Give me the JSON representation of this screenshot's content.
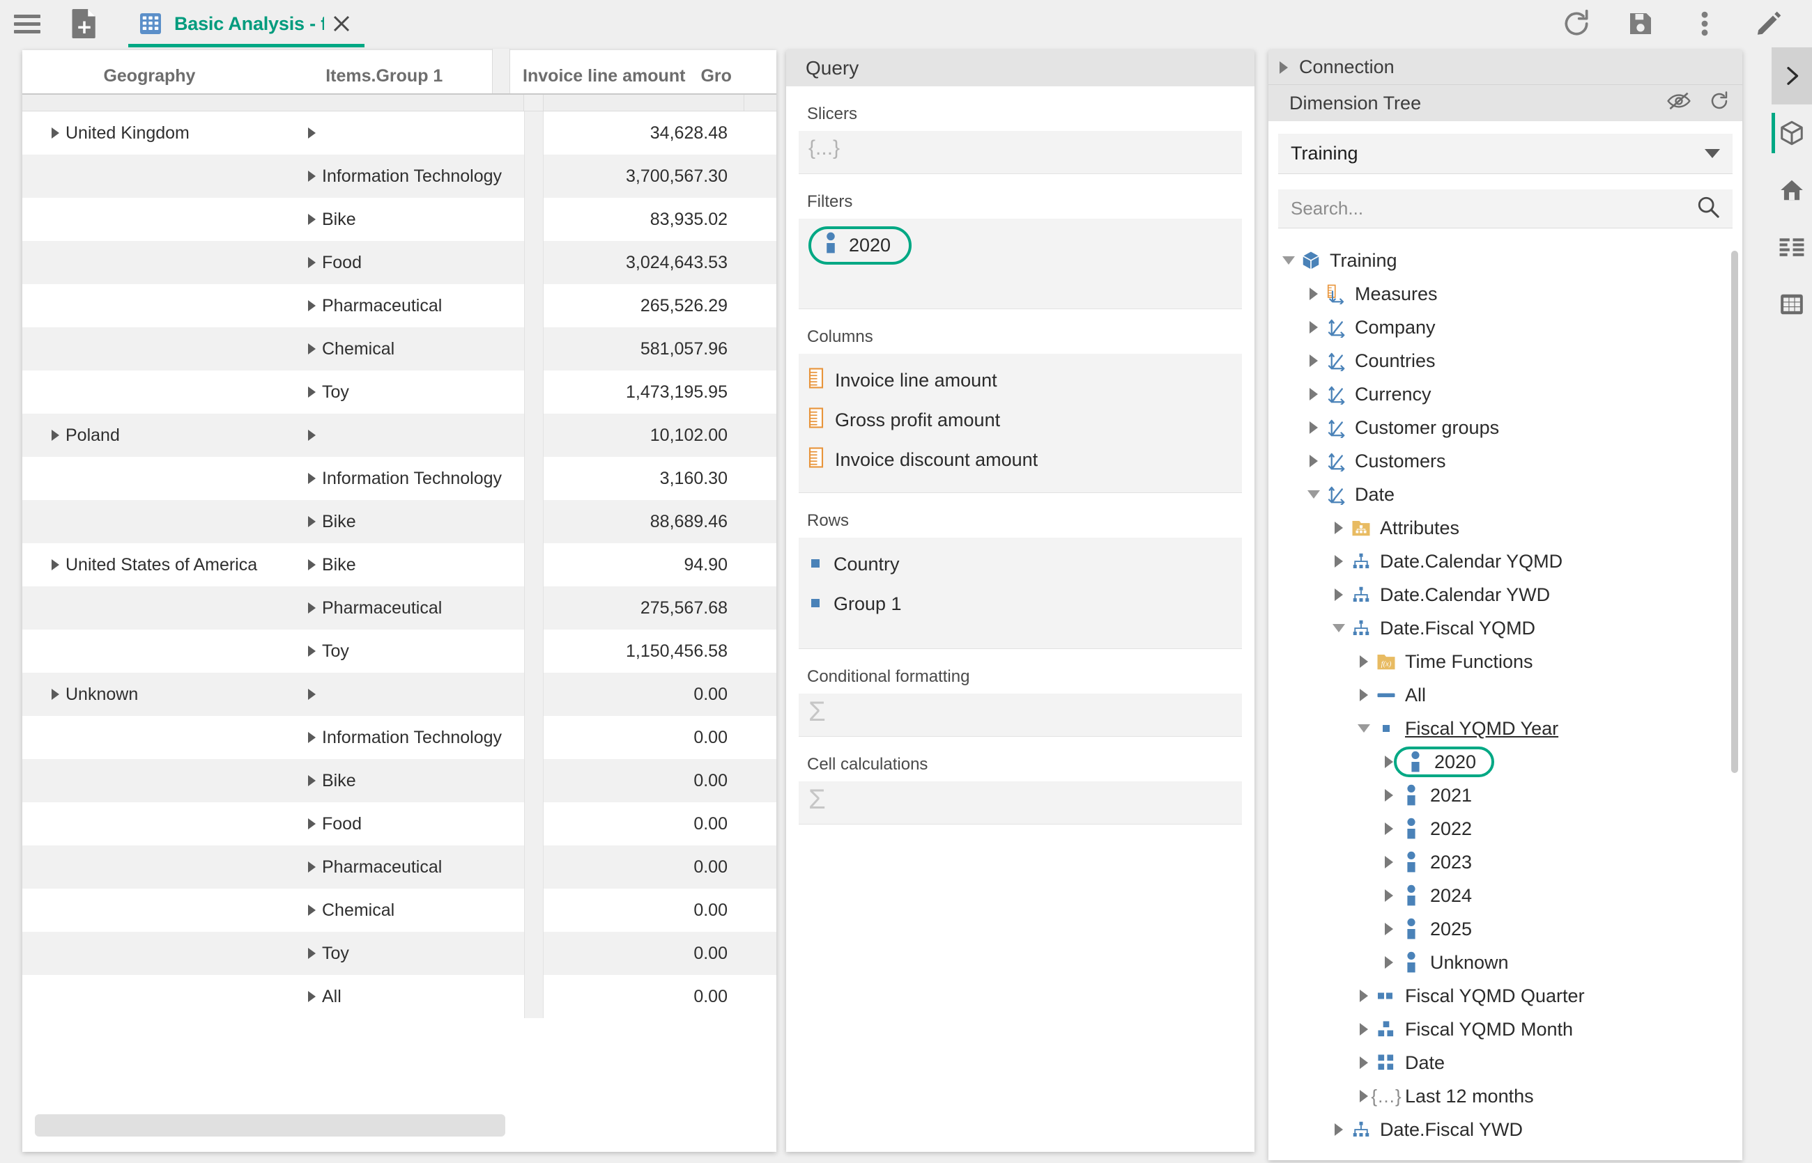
{
  "topbar": {
    "menu_icon": "hamburger-icon",
    "new_doc_icon": "new-document-icon",
    "tab": {
      "icon": "grid-icon",
      "label": "Basic Analysis - filtere",
      "close_icon": "close-icon"
    },
    "actions": [
      {
        "name": "refresh-button",
        "icon": "refresh-icon"
      },
      {
        "name": "save-button",
        "icon": "floppy-save-icon"
      },
      {
        "name": "more-menu-button",
        "icon": "kebab-menu-icon"
      },
      {
        "name": "edit-button",
        "icon": "pencil-icon"
      }
    ]
  },
  "grid": {
    "headers": {
      "geography": "Geography",
      "group": "Items.Group 1",
      "invoice": "Invoice line amount",
      "gross": "Gro"
    },
    "rows": [
      {
        "geo": "United Kingdom",
        "group": "",
        "value": "34,628.48",
        "alt": false
      },
      {
        "geo": "",
        "group": "Information Technology",
        "value": "3,700,567.30",
        "alt": true
      },
      {
        "geo": "",
        "group": "Bike",
        "value": "83,935.02",
        "alt": false
      },
      {
        "geo": "",
        "group": "Food",
        "value": "3,024,643.53",
        "alt": true
      },
      {
        "geo": "",
        "group": "Pharmaceutical",
        "value": "265,526.29",
        "alt": false
      },
      {
        "geo": "",
        "group": "Chemical",
        "value": "581,057.96",
        "alt": true
      },
      {
        "geo": "",
        "group": "Toy",
        "value": "1,473,195.95",
        "alt": false
      },
      {
        "geo": "Poland",
        "group": "",
        "value": "10,102.00",
        "alt": true
      },
      {
        "geo": "",
        "group": "Information Technology",
        "value": "3,160.30",
        "alt": false
      },
      {
        "geo": "",
        "group": "Bike",
        "value": "88,689.46",
        "alt": true
      },
      {
        "geo": "United States of America",
        "group": "Bike",
        "value": "94.90",
        "alt": false
      },
      {
        "geo": "",
        "group": "Pharmaceutical",
        "value": "275,567.68",
        "alt": true
      },
      {
        "geo": "",
        "group": "Toy",
        "value": "1,150,456.58",
        "alt": false
      },
      {
        "geo": "Unknown",
        "group": "",
        "value": "0.00",
        "alt": true
      },
      {
        "geo": "",
        "group": "Information Technology",
        "value": "0.00",
        "alt": false
      },
      {
        "geo": "",
        "group": "Bike",
        "value": "0.00",
        "alt": true
      },
      {
        "geo": "",
        "group": "Food",
        "value": "0.00",
        "alt": false
      },
      {
        "geo": "",
        "group": "Pharmaceutical",
        "value": "0.00",
        "alt": true
      },
      {
        "geo": "",
        "group": "Chemical",
        "value": "0.00",
        "alt": false
      },
      {
        "geo": "",
        "group": "Toy",
        "value": "0.00",
        "alt": true
      },
      {
        "geo": "",
        "group": "All",
        "value": "0.00",
        "alt": false
      }
    ]
  },
  "query": {
    "title": "Query",
    "slicers_label": "Slicers",
    "slicers_placeholder_icon": "{...}",
    "filters_label": "Filters",
    "filters": [
      {
        "label": "2020",
        "icon": "member-icon",
        "highlighted": true
      }
    ],
    "columns_label": "Columns",
    "columns": [
      {
        "label": "Invoice line amount",
        "icon": "measure-icon"
      },
      {
        "label": "Gross profit amount",
        "icon": "measure-icon"
      },
      {
        "label": "Invoice discount amount",
        "icon": "measure-icon"
      }
    ],
    "rows_label": "Rows",
    "rows": [
      {
        "label": "Country",
        "icon": "level-icon"
      },
      {
        "label": "Group 1",
        "icon": "level-icon"
      }
    ],
    "conditional_formatting_label": "Conditional formatting",
    "cell_calculations_label": "Cell calculations",
    "sigma_icon": "sigma-icon"
  },
  "tree_panel": {
    "connection_label": "Connection",
    "dimension_tree_label": "Dimension Tree",
    "hide_icon": "eye-off-icon",
    "refresh_icon": "refresh-icon",
    "cube_selected": "Training",
    "search_placeholder": "Search...",
    "search_icon": "search-icon",
    "nodes": [
      {
        "label": "Training",
        "icon": "cube-icon",
        "indent": 0,
        "state": "expanded"
      },
      {
        "label": "Measures",
        "icon": "measures-icon",
        "indent": 1,
        "state": "collapsed"
      },
      {
        "label": "Company",
        "icon": "dimension-icon",
        "indent": 1,
        "state": "collapsed"
      },
      {
        "label": "Countries",
        "icon": "dimension-icon",
        "indent": 1,
        "state": "collapsed"
      },
      {
        "label": "Currency",
        "icon": "dimension-icon",
        "indent": 1,
        "state": "collapsed"
      },
      {
        "label": "Customer groups",
        "icon": "dimension-icon",
        "indent": 1,
        "state": "collapsed"
      },
      {
        "label": "Customers",
        "icon": "dimension-icon",
        "indent": 1,
        "state": "collapsed"
      },
      {
        "label": "Date",
        "icon": "dimension-icon",
        "indent": 1,
        "state": "expanded"
      },
      {
        "label": "Attributes",
        "icon": "attributes-folder-icon",
        "indent": 2,
        "state": "collapsed"
      },
      {
        "label": "Date.Calendar YQMD",
        "icon": "hierarchy-icon",
        "indent": 2,
        "state": "collapsed"
      },
      {
        "label": "Date.Calendar YWD",
        "icon": "hierarchy-icon",
        "indent": 2,
        "state": "collapsed"
      },
      {
        "label": "Date.Fiscal YQMD",
        "icon": "hierarchy-icon",
        "indent": 2,
        "state": "expanded"
      },
      {
        "label": "Time Functions",
        "icon": "time-functions-folder-icon",
        "indent": 3,
        "state": "collapsed"
      },
      {
        "label": "All",
        "icon": "all-level-icon",
        "indent": 3,
        "state": "collapsed"
      },
      {
        "label": "Fiscal YQMD Year",
        "icon": "level-1-icon",
        "indent": 3,
        "state": "expanded",
        "underline": true
      },
      {
        "label": "2020",
        "icon": "member-icon",
        "indent": 4,
        "state": "collapsed",
        "highlighted": true
      },
      {
        "label": "2021",
        "icon": "member-icon",
        "indent": 4,
        "state": "collapsed"
      },
      {
        "label": "2022",
        "icon": "member-icon",
        "indent": 4,
        "state": "collapsed"
      },
      {
        "label": "2023",
        "icon": "member-icon",
        "indent": 4,
        "state": "collapsed"
      },
      {
        "label": "2024",
        "icon": "member-icon",
        "indent": 4,
        "state": "collapsed"
      },
      {
        "label": "2025",
        "icon": "member-icon",
        "indent": 4,
        "state": "collapsed"
      },
      {
        "label": "Unknown",
        "icon": "member-icon",
        "indent": 4,
        "state": "collapsed"
      },
      {
        "label": "Fiscal YQMD Quarter",
        "icon": "level-2-icon",
        "indent": 3,
        "state": "collapsed"
      },
      {
        "label": "Fiscal YQMD Month",
        "icon": "level-3-icon",
        "indent": 3,
        "state": "collapsed"
      },
      {
        "label": "Date",
        "icon": "level-4-icon",
        "indent": 3,
        "state": "collapsed"
      },
      {
        "label": "Last 12 months",
        "icon": "set-icon",
        "indent": 3,
        "state": "collapsed"
      },
      {
        "label": "Date.Fiscal YWD",
        "icon": "hierarchy-icon",
        "indent": 2,
        "state": "collapsed"
      }
    ]
  },
  "rail": [
    {
      "name": "collapse-panel-button",
      "icon": "chevron-right-icon",
      "active": false
    },
    {
      "name": "rail-cube-button",
      "icon": "cube-icon",
      "active": true
    },
    {
      "name": "rail-home-button",
      "icon": "home-icon",
      "active": false
    },
    {
      "name": "rail-list-button",
      "icon": "list-icon",
      "active": false
    },
    {
      "name": "rail-table-button",
      "icon": "table-icon",
      "active": false
    }
  ],
  "colors": {
    "accent_teal": "#00a884",
    "tab_text": "#009b7d",
    "measure_orange": "#e8943a",
    "member_blue": "#4a82b8",
    "panel_bg": "#efefef"
  }
}
